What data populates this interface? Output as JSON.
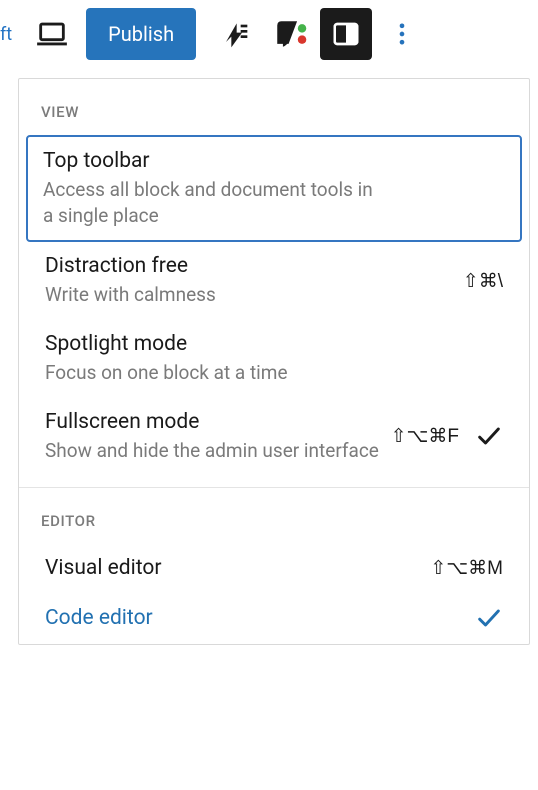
{
  "toolbar": {
    "draft_fragment": "ft",
    "publish_label": "Publish"
  },
  "menu": {
    "section_view": "VIEW",
    "section_editor": "EDITOR",
    "items": {
      "top_toolbar": {
        "title": "Top toolbar",
        "desc": "Access all block and document tools in a single place"
      },
      "distraction_free": {
        "title": "Distraction free",
        "desc": "Write with calmness",
        "shortcut": "⇧⌘\\"
      },
      "spotlight": {
        "title": "Spotlight mode",
        "desc": "Focus on one block at a time"
      },
      "fullscreen": {
        "title": "Fullscreen mode",
        "desc": "Show and hide the admin user interface",
        "shortcut": "⇧⌥⌘F"
      },
      "visual_editor": {
        "title": "Visual editor",
        "shortcut": "⇧⌥⌘M"
      },
      "code_editor": {
        "title": "Code editor"
      }
    }
  }
}
